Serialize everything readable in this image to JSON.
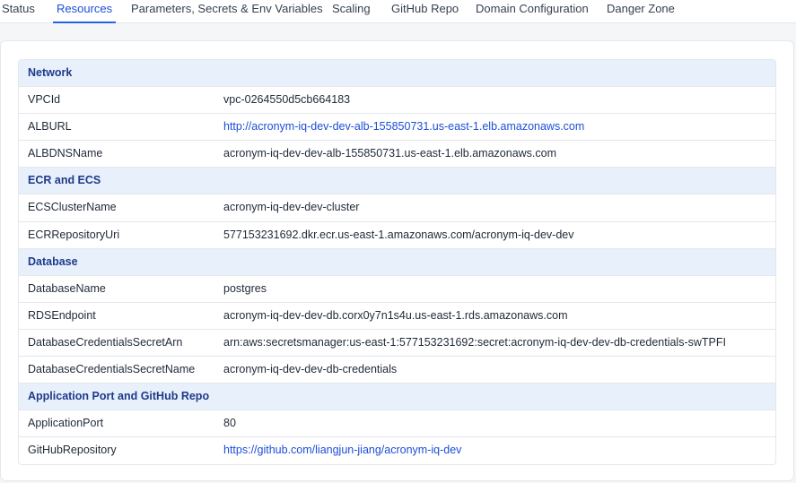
{
  "tabs": [
    {
      "label": "Status",
      "active": false
    },
    {
      "label": "Resources",
      "active": true
    },
    {
      "label": "Parameters, Secrets & Env Variables",
      "active": false
    },
    {
      "label": "Scaling",
      "active": false
    },
    {
      "label": "GitHub Repo",
      "active": false
    },
    {
      "label": "Domain Configuration",
      "active": false
    },
    {
      "label": "Danger Zone",
      "active": false
    }
  ],
  "sections": [
    {
      "title": "Network",
      "rows": [
        {
          "key": "VPCId",
          "value": "vpc-0264550d5cb664183",
          "link": false
        },
        {
          "key": "ALBURL",
          "value": "http://acronym-iq-dev-dev-alb-155850731.us-east-1.elb.amazonaws.com",
          "link": true
        },
        {
          "key": "ALBDNSName",
          "value": "acronym-iq-dev-dev-alb-155850731.us-east-1.elb.amazonaws.com",
          "link": false
        }
      ]
    },
    {
      "title": "ECR and ECS",
      "rows": [
        {
          "key": "ECSClusterName",
          "value": "acronym-iq-dev-dev-cluster",
          "link": false
        },
        {
          "key": "ECRRepositoryUri",
          "value": "577153231692.dkr.ecr.us-east-1.amazonaws.com/acronym-iq-dev-dev",
          "link": false
        }
      ]
    },
    {
      "title": "Database",
      "rows": [
        {
          "key": "DatabaseName",
          "value": "postgres",
          "link": false
        },
        {
          "key": "RDSEndpoint",
          "value": "acronym-iq-dev-dev-db.corx0y7n1s4u.us-east-1.rds.amazonaws.com",
          "link": false
        },
        {
          "key": "DatabaseCredentialsSecretArn",
          "value": "arn:aws:secretsmanager:us-east-1:577153231692:secret:acronym-iq-dev-dev-db-credentials-swTPFI",
          "link": false
        },
        {
          "key": "DatabaseCredentialsSecretName",
          "value": "acronym-iq-dev-dev-db-credentials",
          "link": false
        }
      ]
    },
    {
      "title": "Application Port and GitHub Repo",
      "rows": [
        {
          "key": "ApplicationPort",
          "value": "80",
          "link": false
        },
        {
          "key": "GitHubRepository",
          "value": "https://github.com/liangjun-jiang/acronym-iq-dev",
          "link": true
        }
      ]
    }
  ],
  "colors": {
    "accent": "#2563eb",
    "link": "#1d4ed8",
    "section_bg": "#e8f0fb",
    "section_text": "#1e3a8a"
  }
}
